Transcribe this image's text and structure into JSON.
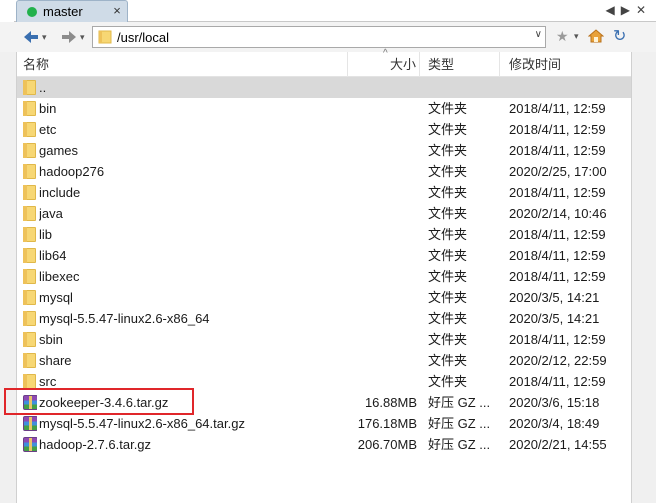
{
  "tab": {
    "label": "master",
    "close_glyph": "×",
    "status_color": "#22b14c",
    "scroll_left": "◀",
    "scroll_right": "▶",
    "menu": "✕"
  },
  "toolbar": {
    "back_icon": "arrow-left-icon",
    "forward_icon": "arrow-right-icon",
    "address": "/usr/local",
    "star_icon": "star-icon",
    "home_icon": "home-icon",
    "refresh_icon": "refresh-icon"
  },
  "columns": {
    "name": "名称",
    "size": "大小",
    "type": "类型",
    "modified": "修改时间"
  },
  "files": [
    {
      "name": "..",
      "size": "",
      "type": "",
      "modified": "",
      "icon": "folder-icon",
      "selected": true
    },
    {
      "name": "bin",
      "size": "",
      "type": "文件夹",
      "modified": "2018/4/11, 12:59",
      "icon": "folder-icon"
    },
    {
      "name": "etc",
      "size": "",
      "type": "文件夹",
      "modified": "2018/4/11, 12:59",
      "icon": "folder-icon"
    },
    {
      "name": "games",
      "size": "",
      "type": "文件夹",
      "modified": "2018/4/11, 12:59",
      "icon": "folder-icon"
    },
    {
      "name": "hadoop276",
      "size": "",
      "type": "文件夹",
      "modified": "2020/2/25, 17:00",
      "icon": "folder-icon"
    },
    {
      "name": "include",
      "size": "",
      "type": "文件夹",
      "modified": "2018/4/11, 12:59",
      "icon": "folder-icon"
    },
    {
      "name": "java",
      "size": "",
      "type": "文件夹",
      "modified": "2020/2/14, 10:46",
      "icon": "folder-icon"
    },
    {
      "name": "lib",
      "size": "",
      "type": "文件夹",
      "modified": "2018/4/11, 12:59",
      "icon": "folder-icon"
    },
    {
      "name": "lib64",
      "size": "",
      "type": "文件夹",
      "modified": "2018/4/11, 12:59",
      "icon": "folder-icon"
    },
    {
      "name": "libexec",
      "size": "",
      "type": "文件夹",
      "modified": "2018/4/11, 12:59",
      "icon": "folder-icon"
    },
    {
      "name": "mysql",
      "size": "",
      "type": "文件夹",
      "modified": "2020/3/5, 14:21",
      "icon": "folder-icon"
    },
    {
      "name": "mysql-5.5.47-linux2.6-x86_64",
      "size": "",
      "type": "文件夹",
      "modified": "2020/3/5, 14:21",
      "icon": "folder-icon"
    },
    {
      "name": "sbin",
      "size": "",
      "type": "文件夹",
      "modified": "2018/4/11, 12:59",
      "icon": "folder-icon"
    },
    {
      "name": "share",
      "size": "",
      "type": "文件夹",
      "modified": "2020/2/12, 22:59",
      "icon": "folder-icon"
    },
    {
      "name": "src",
      "size": "",
      "type": "文件夹",
      "modified": "2018/4/11, 12:59",
      "icon": "folder-icon"
    },
    {
      "name": "zookeeper-3.4.6.tar.gz",
      "size": "16.88MB",
      "type": "好压 GZ ...",
      "modified": "2020/3/6, 15:18",
      "icon": "archive-icon",
      "highlighted": true
    },
    {
      "name": "mysql-5.5.47-linux2.6-x86_64.tar.gz",
      "size": "176.18MB",
      "type": "好压 GZ ...",
      "modified": "2020/3/4, 18:49",
      "icon": "archive-icon"
    },
    {
      "name": "hadoop-2.7.6.tar.gz",
      "size": "206.70MB",
      "type": "好压 GZ ...",
      "modified": "2020/2/21, 14:55",
      "icon": "archive-icon"
    }
  ],
  "colors": {
    "selection": "#d9d9d9",
    "highlight_border": "#e0262a",
    "folder": "#f7d774"
  }
}
